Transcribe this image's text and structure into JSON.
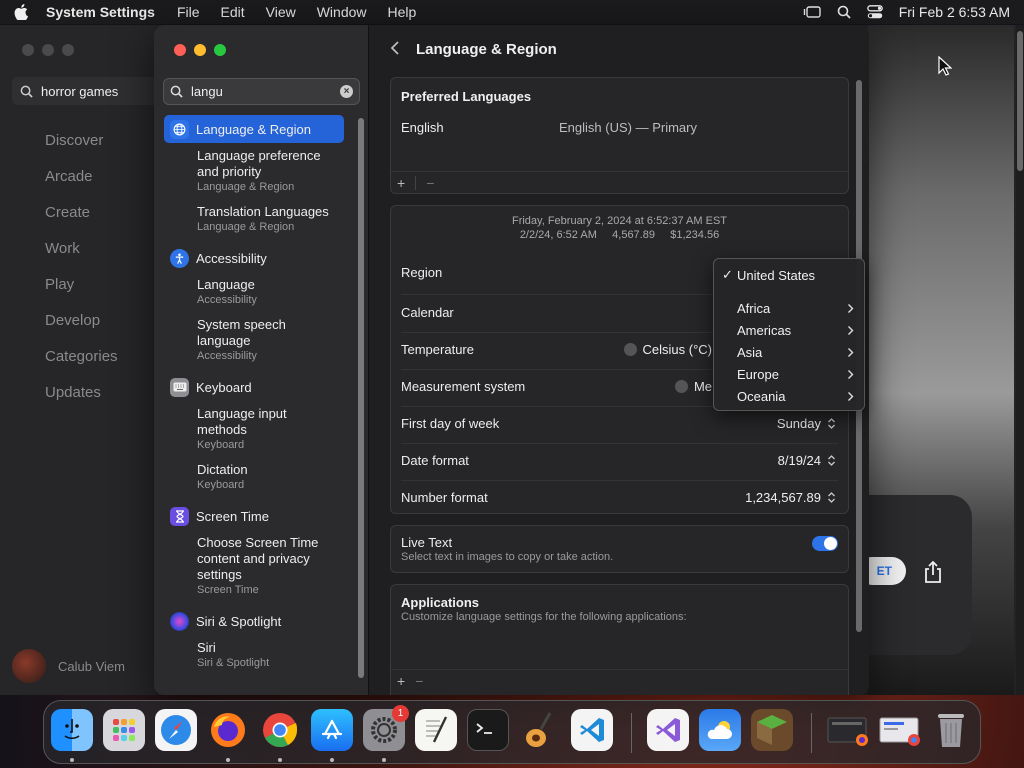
{
  "menubar": {
    "app_name": "System Settings",
    "menus": [
      "File",
      "Edit",
      "View",
      "Window",
      "Help"
    ],
    "clock": "Fri Feb 2  6:53 AM"
  },
  "background_app": {
    "search_value": "horror games",
    "nav": [
      "Discover",
      "Arcade",
      "Create",
      "Work",
      "Play",
      "Develop",
      "Categories",
      "Updates"
    ],
    "user_name": "Calub Viem",
    "get_label": "ET"
  },
  "settings": {
    "search_value": "langu",
    "sidebar": [
      {
        "label": "Language & Region",
        "icon": "globe-icon",
        "icon_color": "#2e74e8",
        "active": true,
        "subs": [
          {
            "title": "Language preference and priority",
            "caption": "Language & Region"
          },
          {
            "title": "Translation Languages",
            "caption": "Language & Region"
          }
        ]
      },
      {
        "label": "Accessibility",
        "icon": "accessibility-icon",
        "icon_color": "#2e74e8",
        "active": false,
        "subs": [
          {
            "title": "Language",
            "caption": "Accessibility"
          },
          {
            "title": "System speech language",
            "caption": "Accessibility"
          }
        ]
      },
      {
        "label": "Keyboard",
        "icon": "keyboard-icon",
        "icon_color": "#8e8e93",
        "active": false,
        "subs": [
          {
            "title": "Language input methods",
            "caption": "Keyboard"
          },
          {
            "title": "Dictation",
            "caption": "Keyboard"
          }
        ]
      },
      {
        "label": "Screen Time",
        "icon": "hourglass-icon",
        "icon_color": "#6a4ee0",
        "active": false,
        "subs": [
          {
            "title": "Choose Screen Time content and privacy settings",
            "caption": "Screen Time"
          }
        ]
      },
      {
        "label": "Siri & Spotlight",
        "icon": "siri-icon",
        "icon_color": "#b04ad0",
        "active": false,
        "subs": [
          {
            "title": "Siri",
            "caption": "Siri & Spotlight"
          }
        ]
      }
    ],
    "page_title": "Language & Region",
    "preferred": {
      "heading": "Preferred Languages",
      "language": "English",
      "language_detail": "English (US) — Primary",
      "add": "+",
      "remove": "−"
    },
    "format": {
      "preview_line1": "Friday, February 2, 2024 at 6:52:37 AM EST",
      "preview_line2": "2/2/24, 6:52 AM     4,567.89     $1,234.56",
      "region_label": "Region",
      "calendar_label": "Calendar",
      "temperature_label": "Temperature",
      "temperature_option": "Celsius (°C)",
      "measurement_label": "Measurement system",
      "measurement_option": "Me",
      "first_day_label": "First day of week",
      "first_day_value": "Sunday",
      "date_format_label": "Date format",
      "date_format_value": "8/19/24",
      "number_format_label": "Number format",
      "number_format_value": "1,234,567.89"
    },
    "live_text": {
      "label": "Live Text",
      "caption": "Select text in images to copy or take action.",
      "enabled": true
    },
    "applications": {
      "heading": "Applications",
      "caption": "Customize language settings for the following applications:",
      "add": "+",
      "remove": "−"
    },
    "region_popup": {
      "selected": "United States",
      "check": "✓",
      "continents": [
        "Africa",
        "Americas",
        "Asia",
        "Europe",
        "Oceania"
      ]
    }
  },
  "dock": {
    "apps": [
      "finder-icon",
      "launchpad-icon",
      "safari-icon",
      "firefox-icon",
      "chrome-icon",
      "app-store-icon",
      "system-settings-icon",
      "textedit-icon",
      "terminal-icon",
      "garageband-icon",
      "vscode-icon",
      "visual-studio-icon",
      "weather-icon",
      "minecraft-icon"
    ],
    "settings_badge": "1"
  }
}
